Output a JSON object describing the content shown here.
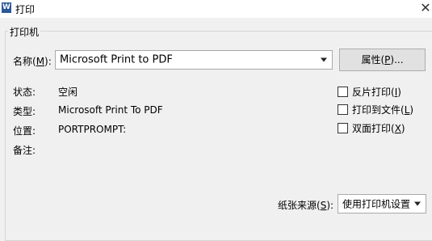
{
  "window": {
    "title": "打印",
    "app_icon": "W"
  },
  "printer_group": {
    "legend": "打印机"
  },
  "name_row": {
    "label_prefix": "名称(",
    "label_key": "M",
    "label_suffix": "):",
    "selected": "Microsoft Print to PDF"
  },
  "properties_button": {
    "label_prefix": "属性(",
    "label_key": "P",
    "label_suffix": ")..."
  },
  "info": {
    "status_label": "状态:",
    "status_value": "空闲",
    "type_label": "类型:",
    "type_value": "Microsoft Print To PDF",
    "location_label": "位置:",
    "location_value": "PORTPROMPT:",
    "comment_label": "备注:"
  },
  "options": [
    {
      "prefix": "反片打印(",
      "key": "I",
      "suffix": ")",
      "checked": false
    },
    {
      "prefix": "打印到文件(",
      "key": "L",
      "suffix": ")",
      "checked": false
    },
    {
      "prefix": "双面打印(",
      "key": "X",
      "suffix": ")",
      "checked": false
    }
  ],
  "paper_source": {
    "label_prefix": "纸张来源(",
    "label_key": "S",
    "label_suffix": "):",
    "selected": "使用打印机设置"
  }
}
